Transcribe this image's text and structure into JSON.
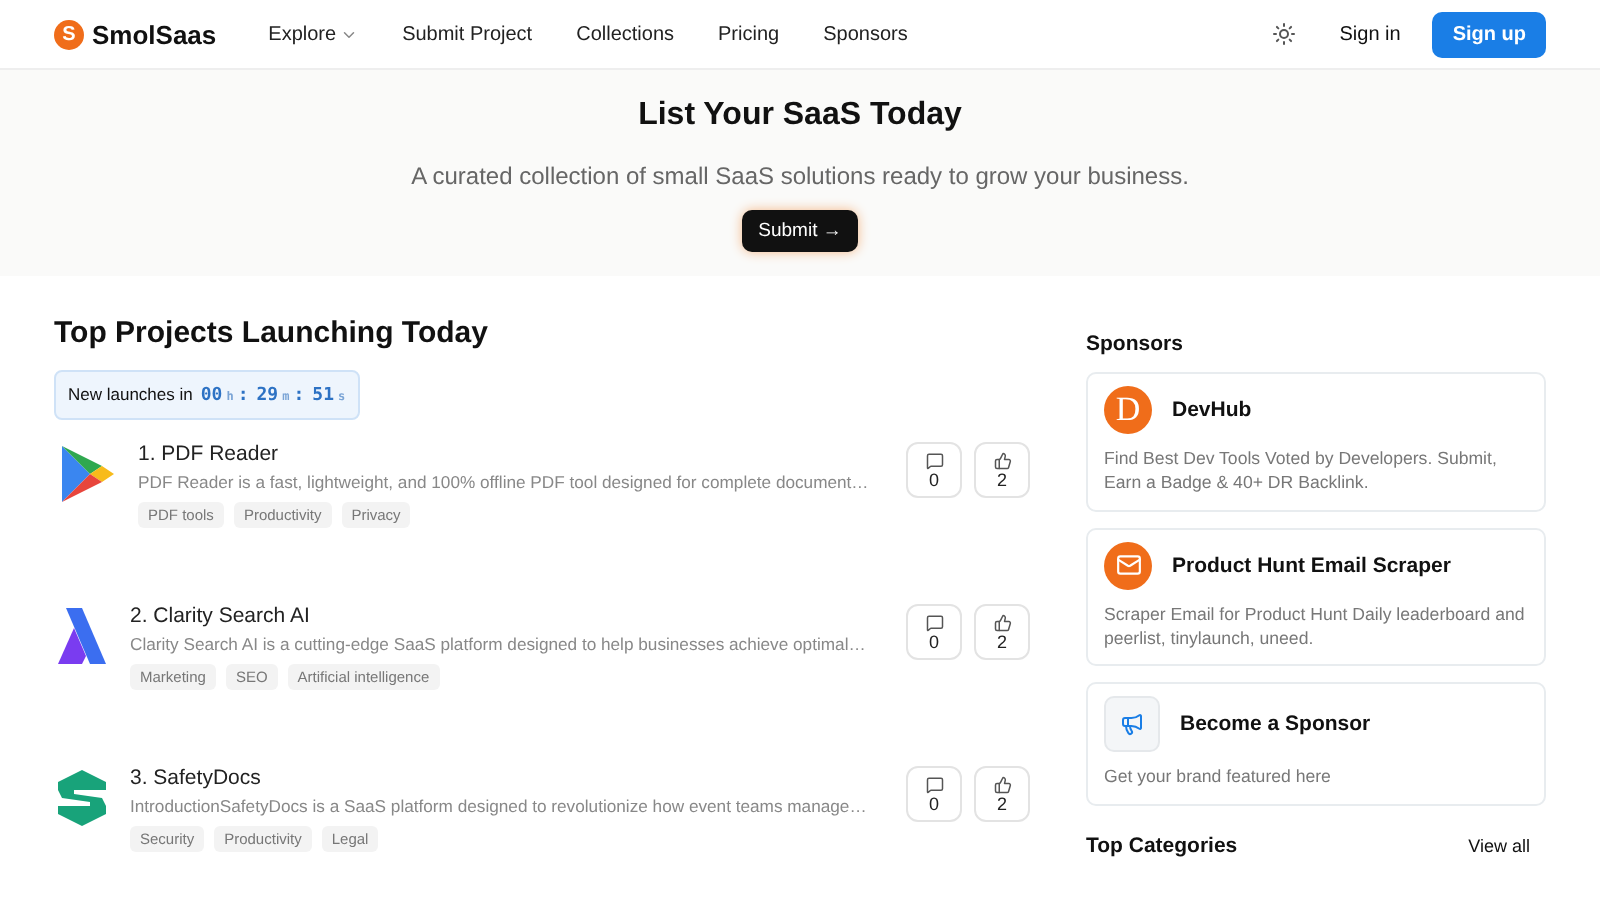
{
  "header": {
    "logo_mark": "S",
    "brand": "SmolSaas",
    "nav": [
      {
        "label": "Explore",
        "dropdown": true
      },
      {
        "label": "Submit Project",
        "dropdown": false
      },
      {
        "label": "Collections",
        "dropdown": false
      },
      {
        "label": "Pricing",
        "dropdown": false
      },
      {
        "label": "Sponsors",
        "dropdown": false
      }
    ],
    "sign_in": "Sign in",
    "sign_up": "Sign up"
  },
  "hero": {
    "title": "List Your SaaS Today",
    "subtitle": "A curated collection of small SaaS solutions ready to grow your business.",
    "button": "Submit →"
  },
  "projects": {
    "title": "Top Projects Launching Today",
    "timer": {
      "label": "New launches in",
      "parts": [
        {
          "kind": "value",
          "text": "00"
        },
        {
          "kind": "unit",
          "text": "h"
        },
        {
          "kind": "sep",
          "text": ":"
        },
        {
          "kind": "value",
          "text": "29"
        },
        {
          "kind": "unit",
          "text": "m"
        },
        {
          "kind": "sep",
          "text": ":"
        },
        {
          "kind": "value",
          "text": "51"
        },
        {
          "kind": "unit",
          "text": "s"
        }
      ]
    },
    "items": [
      {
        "kind": "play",
        "name": "1. PDF Reader",
        "description": "PDF Reader is a fast, lightweight, and 100% offline PDF tool designed for complete document…",
        "tags": [
          "PDF tools",
          "Productivity",
          "Privacy"
        ],
        "comments": "0",
        "upvotes": "2"
      },
      {
        "kind": "clarity",
        "name": "2. Clarity Search AI",
        "description": "Clarity Search AI is a cutting-edge SaaS platform designed to help businesses achieve optimal…",
        "tags": [
          "Marketing",
          "SEO",
          "Artificial intelligence"
        ],
        "comments": "0",
        "upvotes": "2"
      },
      {
        "kind": "shield",
        "name": "3. SafetyDocs",
        "description": "IntroductionSafetyDocs is a SaaS platform designed to revolutionize how event teams manage…",
        "tags": [
          "Security",
          "Productivity",
          "Legal"
        ],
        "comments": "0",
        "upvotes": "2"
      }
    ]
  },
  "sidebar": {
    "sponsors_title": "Sponsors",
    "sponsors": [
      {
        "kind": "letter",
        "mark": "D",
        "name": "DevHub",
        "description": "Find Best Dev Tools Voted by Developers. Submit, Earn a Badge & 40+ DR Backlink."
      },
      {
        "kind": "mail",
        "name": "Product Hunt Email Scraper",
        "description": "Scraper Email for Product Hunt Daily leaderboard and peerlist, tinylaunch, uneed."
      },
      {
        "kind": "megaphone",
        "name": "Become a Sponsor",
        "description": "Get your brand featured here"
      }
    ],
    "categories_title": "Top Categories",
    "view_all": "View all"
  }
}
